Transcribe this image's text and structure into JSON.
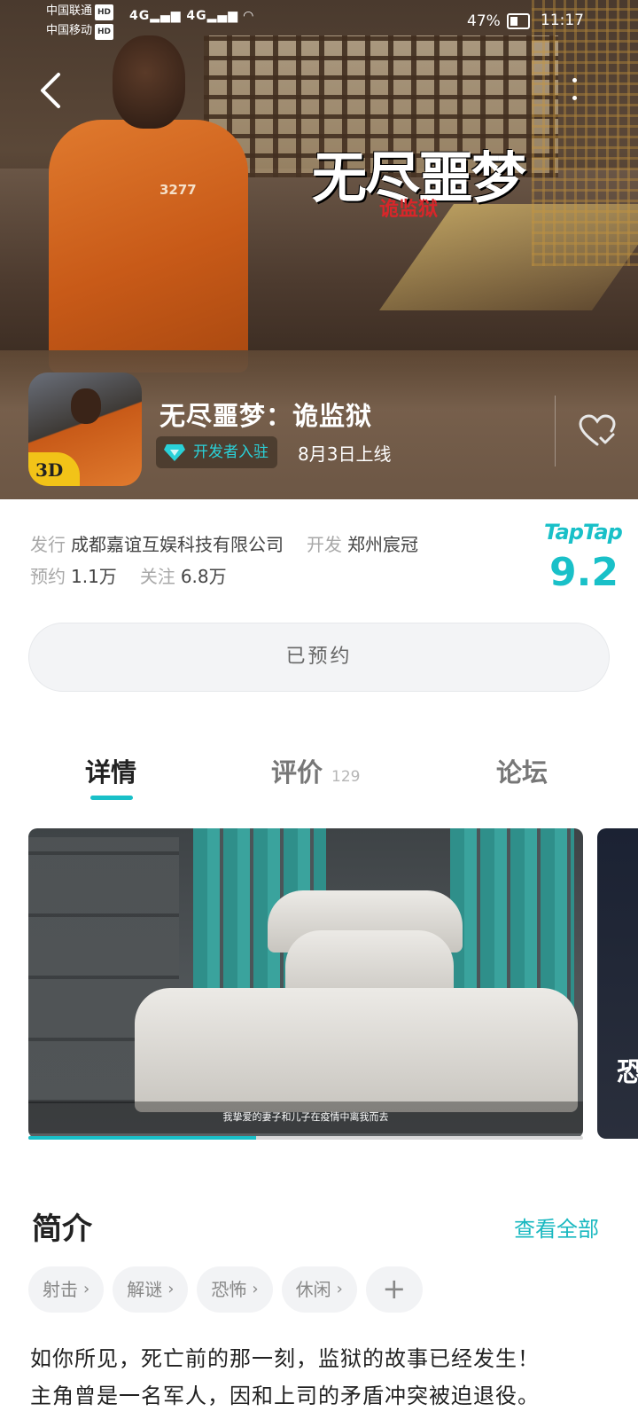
{
  "status_bar": {
    "carrier1": "中国联通",
    "carrier2": "中国移动",
    "hd": "HD",
    "network": "4G",
    "battery": "47%",
    "battery_level": 0.47,
    "time": "11:17"
  },
  "hero": {
    "logo_title": "无尽噩梦",
    "logo_subtitle": "诡监狱",
    "prisoner_number": "3277"
  },
  "game": {
    "title": "无尽噩梦：诡监狱",
    "icon_badge": "3D",
    "dev_badge": "开发者入驻",
    "launch_date": "8月3日上线"
  },
  "meta": {
    "publisher_label": "发行",
    "publisher": "成都嘉谊互娱科技有限公司",
    "developer_label": "开发",
    "developer": "郑州宸冠",
    "reserve_label": "预约",
    "reserve_count": "1.1万",
    "follow_label": "关注",
    "follow_count": "6.8万"
  },
  "rating": {
    "brand": "TapTap",
    "score": "9.2"
  },
  "reserve_button": "已预约",
  "tabs": [
    {
      "label": "详情",
      "count": ""
    },
    {
      "label": "评价",
      "count": "129"
    },
    {
      "label": "论坛",
      "count": ""
    }
  ],
  "screenshot": {
    "caption": "我挚爱的妻子和儿子在疫情中离我而去",
    "progress": 0.41,
    "next_preview_text": "恐"
  },
  "intro": {
    "title": "简介",
    "view_all": "查看全部",
    "tags": [
      "射击",
      "解谜",
      "恐怖",
      "休闲"
    ],
    "text_lines": [
      "如你所见，死亡前的那一刻，监狱的故事已经发生！",
      "主角曾是一名军人，因和上司的矛盾冲突被迫退役。"
    ]
  },
  "colors": {
    "accent": "#19c0c8",
    "hero_bg": "#5b4838"
  }
}
